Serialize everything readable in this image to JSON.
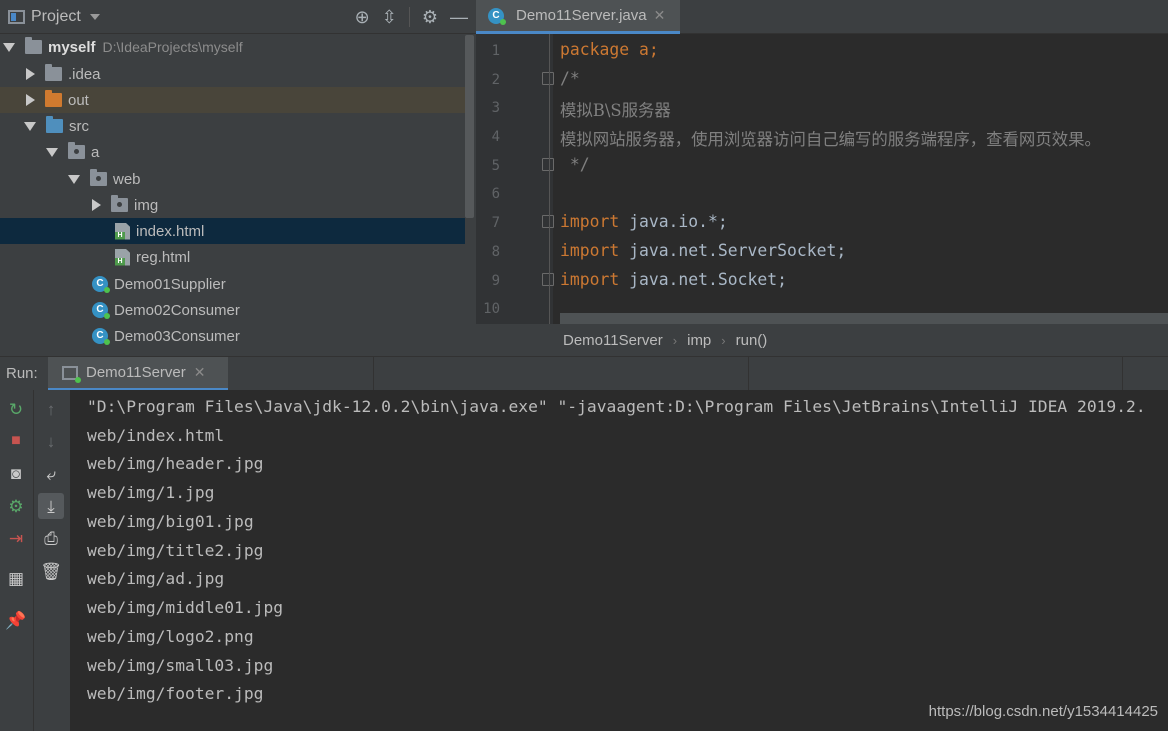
{
  "project_panel": {
    "title": "Project",
    "tree": [
      {
        "label": "myself",
        "path": "D:\\IdeaProjects\\myself"
      },
      {
        "label": ".idea"
      },
      {
        "label": "out"
      },
      {
        "label": "src"
      },
      {
        "label": "a"
      },
      {
        "label": "web"
      },
      {
        "label": "img"
      },
      {
        "label": "index.html"
      },
      {
        "label": "reg.html"
      },
      {
        "label": "Demo01Supplier"
      },
      {
        "label": "Demo02Consumer"
      },
      {
        "label": "Demo03Consumer"
      }
    ]
  },
  "editor": {
    "tab_label": "Demo11Server.java",
    "line_numbers": [
      "1",
      "2",
      "3",
      "4",
      "5",
      "6",
      "7",
      "8",
      "9",
      "10"
    ],
    "code": {
      "l1_kw": "package",
      "l1_rest": " a;",
      "l2": "/*",
      "l3": "模拟B\\S服务器",
      "l4": "模拟网站服务器，使用浏览器访问自己编写的服务端程序，查看网页效果。",
      "l5": " */",
      "l7_kw": "import",
      "l7_rest": " java.io.*;",
      "l8_kw": "import",
      "l8_rest": " java.net.ServerSocket;",
      "l9_kw": "import",
      "l9_rest": " java.net.Socket;"
    },
    "breadcrumb": [
      "Demo11Server",
      "imp",
      "run()"
    ]
  },
  "run_panel": {
    "label": "Run:",
    "tab_label": "Demo11Server",
    "console_lines": [
      "\"D:\\Program Files\\Java\\jdk-12.0.2\\bin\\java.exe\" \"-javaagent:D:\\Program Files\\JetBrains\\IntelliJ IDEA 2019.2.",
      "web/index.html",
      "web/img/header.jpg",
      "web/img/1.jpg",
      "web/img/big01.jpg",
      "web/img/title2.jpg",
      "web/img/ad.jpg",
      "web/img/middle01.jpg",
      "web/img/logo2.png",
      "web/img/small03.jpg",
      "web/img/footer.jpg"
    ],
    "watermark": "https://blog.csdn.net/y1534414425"
  },
  "colors": {
    "keyword": "#cc7832",
    "comment": "#808080",
    "selection": "#0d293e",
    "accent": "#4a88c7"
  }
}
